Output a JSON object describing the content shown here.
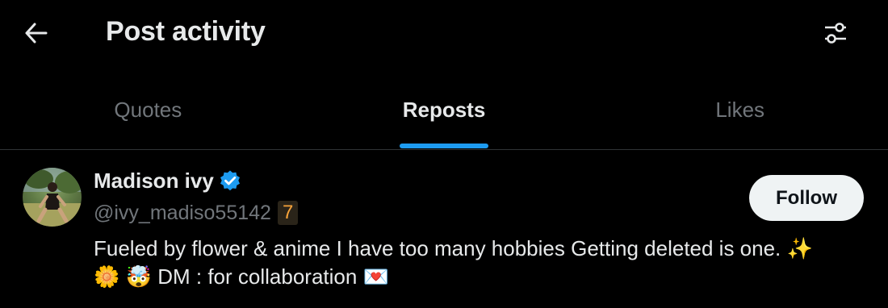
{
  "header": {
    "title": "Post activity",
    "back_icon": "arrow-left-icon",
    "filter_icon": "sliders-icon"
  },
  "tabs": [
    {
      "label": "Quotes",
      "active": false
    },
    {
      "label": "Reposts",
      "active": true
    },
    {
      "label": "Likes",
      "active": false
    }
  ],
  "colors": {
    "accent": "#1d9bf0",
    "background": "#000000",
    "text_primary": "#e7e9ea",
    "text_secondary": "#71767b",
    "badge_text": "#f7a33a"
  },
  "user": {
    "name": "Madison ivy",
    "verified_icon": "verified-badge-icon",
    "handle": "@ivy_madiso55142",
    "badge": "7",
    "bio_text": "Fueled by flower & anime I have too many hobbies Getting deleted is one.",
    "bio_emojis": "✨ 🌼 🤯",
    "bio_text2": "DM : for collaboration",
    "bio_emoji_end": "💌",
    "follow_label": "Follow"
  }
}
